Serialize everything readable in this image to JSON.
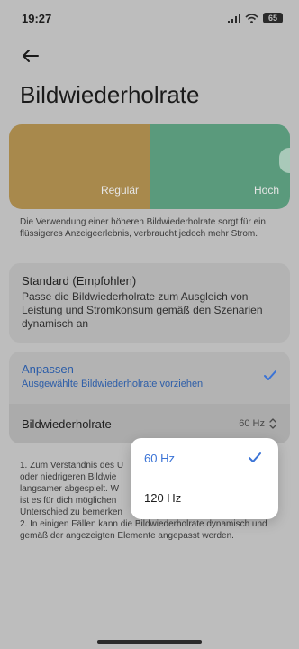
{
  "status_bar": {
    "time": "19:27",
    "battery": "65"
  },
  "header": {
    "title": "Bildwiederholrate"
  },
  "preview": {
    "left_label": "Regulär",
    "right_label": "Hoch"
  },
  "description": "Die Verwendung einer höheren Bildwiederholrate sorgt für ein flüssigeres Anzeigeerlebnis, verbraucht jedoch mehr Strom.",
  "standard": {
    "title": "Standard (Empfohlen)",
    "description": "Passe die Bildwiederholrate zum Ausgleich von Leistung und Stromkonsum gemäß den Szenarien dynamisch an"
  },
  "custom": {
    "title": "Anpassen",
    "subtitle": "Ausgewählte Bildwiederholrate vorziehen",
    "row_label": "Bildwiederholrate",
    "row_value": "60 Hz"
  },
  "notes": {
    "line1": "1. Zum Verständnis des U",
    "line2": "oder niedrigeren Bildwie",
    "line3": "langsamer abgespielt. W",
    "line4": "ist es für dich möglichen",
    "line5": "Unterschied zu bemerken",
    "line6": "2. In einigen Fällen kann die Bildwiederholrate dynamisch und gemäß der angezeigten Elemente angepasst werden."
  },
  "popup": {
    "options": [
      {
        "label": "60 Hz",
        "selected": true
      },
      {
        "label": "120 Hz",
        "selected": false
      }
    ]
  },
  "colors": {
    "accent": "#3a73d6",
    "preview_regular": "#a8894c",
    "preview_high": "#5a9a7c"
  }
}
